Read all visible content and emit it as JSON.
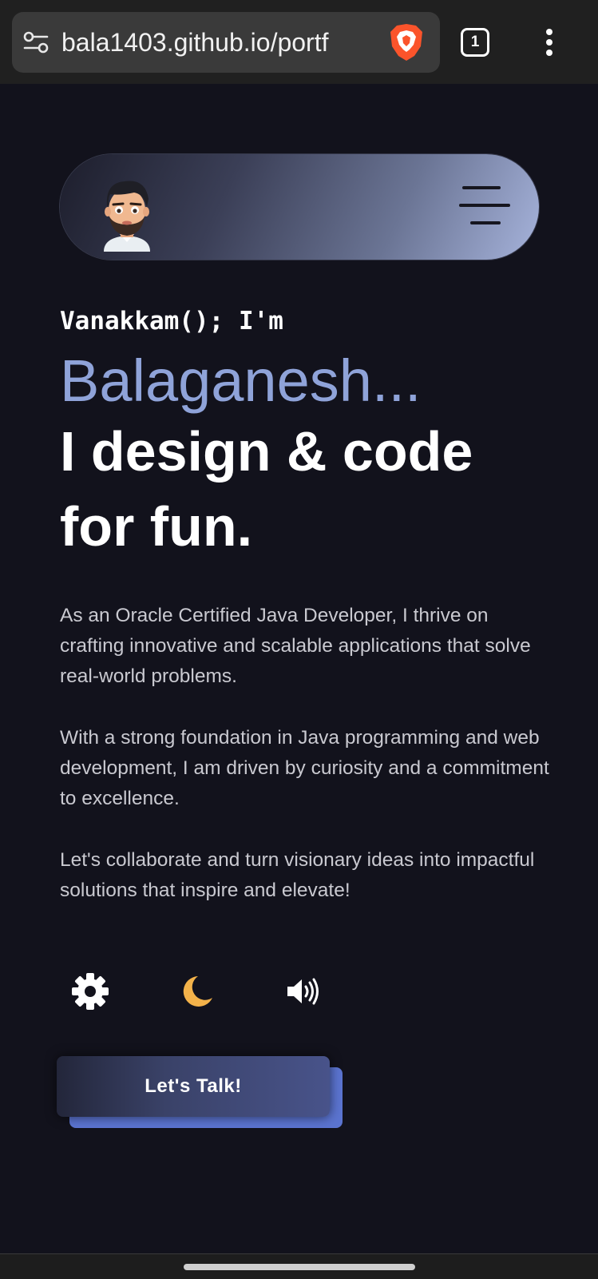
{
  "browser": {
    "url": "bala1403.github.io/portf",
    "tab_count": "1"
  },
  "hero": {
    "greeting": "Vanakkam(); I'm",
    "name": "Balaganesh...",
    "tagline": "I design & code for fun."
  },
  "about": {
    "paragraph_1": "As an Oracle Certified Java Developer, I thrive on crafting innovative and scalable applications that solve real-world problems.",
    "paragraph_2": "With a strong foundation in Java programming and web development, I am driven by curiosity and a commitment to excellence.",
    "paragraph_3": "Let's collaborate and turn visionary ideas into impactful solutions that inspire and elevate!"
  },
  "controls": {
    "icons": [
      "gear-icon",
      "moon-icon",
      "volume-icon"
    ]
  },
  "cta": {
    "label": "Let's Talk!"
  },
  "colors": {
    "background": "#12121c",
    "accent": "#8fa3d9",
    "button_shadow": "#5b74d0",
    "moon": "#f3b24a"
  }
}
